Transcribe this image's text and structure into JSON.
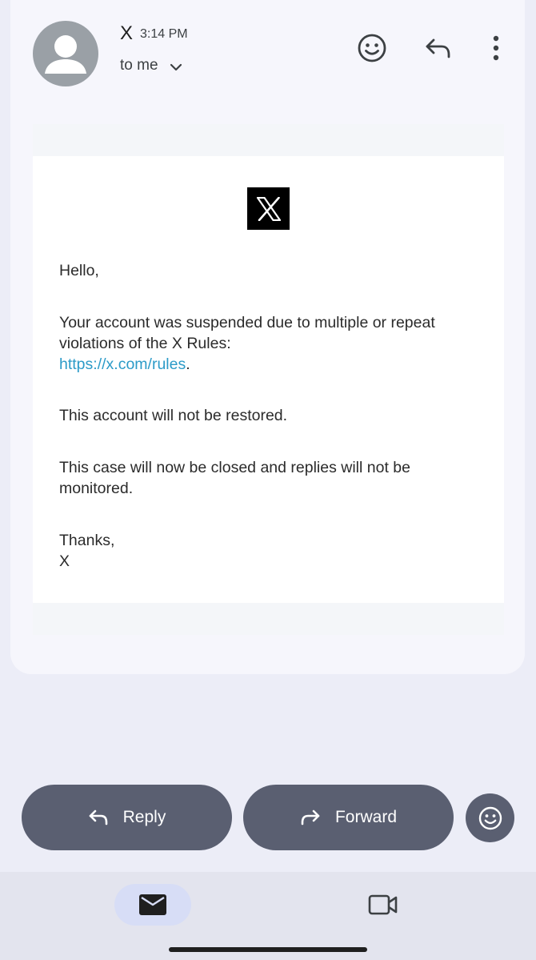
{
  "header": {
    "sender": "X",
    "time": "3:14 PM",
    "recipient": "to me",
    "icons": {
      "avatar": "person-icon",
      "react": "smiley-icon",
      "reply": "reply-arrow-icon",
      "more": "more-vert-icon",
      "expand": "chevron-down-icon"
    }
  },
  "email": {
    "logo_alt": "X",
    "greeting": "Hello,",
    "paragraph1": "Your account was suspended due to multiple or repeat violations of the X Rules:",
    "rules_link": "https://x.com/rules",
    "link_suffix": ".",
    "paragraph2": "This account will not be restored.",
    "paragraph3": "This case will now be closed and replies will not be monitored.",
    "signoff": "Thanks,",
    "signature": "X"
  },
  "actions": {
    "reply_label": "Reply",
    "forward_label": "Forward",
    "emoji_icon": "smiley-icon"
  },
  "bottom_nav": {
    "mail_icon": "mail-icon",
    "meet_icon": "video-icon"
  },
  "colors": {
    "background": "#ECEDF7",
    "card": "#F6F6FC",
    "button": "#5A5F71",
    "link": "#2C9BC8",
    "nav_active": "#D7DDF6"
  }
}
